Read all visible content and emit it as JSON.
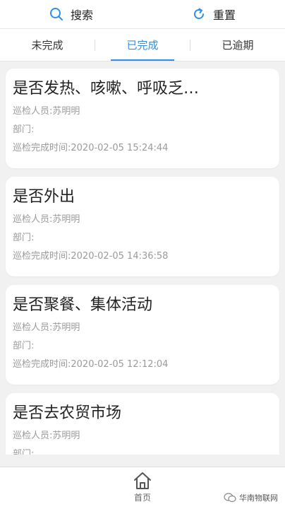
{
  "toolbar": {
    "search_label": "搜索",
    "reset_label": "重置",
    "search_icon": "search-icon",
    "reset_icon": "refresh-icon"
  },
  "tabs": [
    {
      "label": "未完成",
      "active": false
    },
    {
      "label": "已完成",
      "active": true
    },
    {
      "label": "已逾期",
      "active": false
    }
  ],
  "records": [
    {
      "title": "是否发热、咳嗽、呼吸乏…",
      "inspector": "巡检人员:苏明明",
      "department": "部门:",
      "completed_time": "巡检完成时间:2020-02-05 15:24:44"
    },
    {
      "title": "是否外出",
      "inspector": "巡检人员:苏明明",
      "department": "部门:",
      "completed_time": "巡检完成时间:2020-02-05 14:36:58"
    },
    {
      "title": "是否聚餐、集体活动",
      "inspector": "巡检人员:苏明明",
      "department": "部门:",
      "completed_time": "巡检完成时间:2020-02-05 12:12:04"
    },
    {
      "title": "是否去农贸市场",
      "inspector": "巡检人员:苏明明",
      "department": "部门:"
    }
  ],
  "bottom_nav": {
    "home_label": "首页",
    "home_icon": "home-icon"
  },
  "watermark": {
    "text": "华南物联网"
  },
  "colors": {
    "accent": "#2f8fe6",
    "background": "#f1f1f1"
  }
}
